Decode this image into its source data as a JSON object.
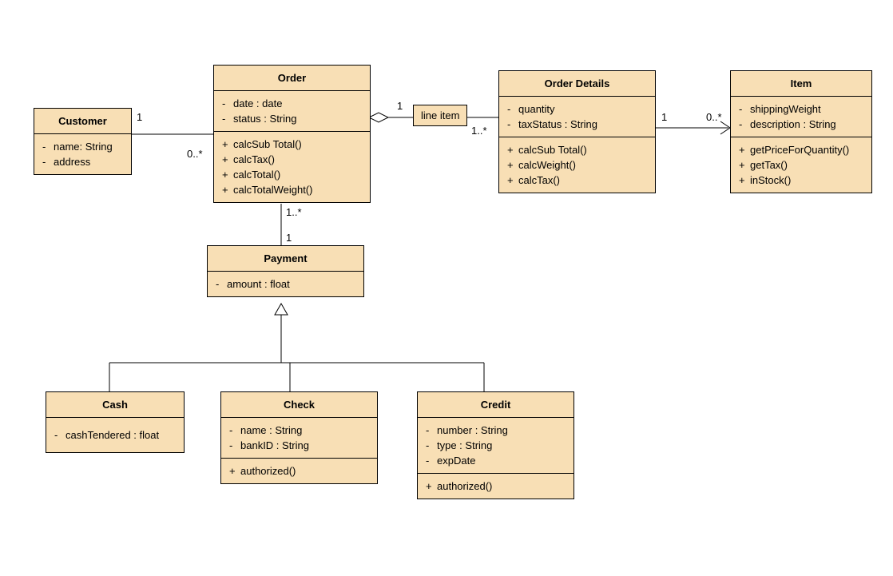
{
  "classes": {
    "customer": {
      "name": "Customer",
      "attrs": [
        {
          "vis": "-",
          "text": "name: String"
        },
        {
          "vis": "-",
          "text": "address"
        }
      ]
    },
    "order": {
      "name": "Order",
      "attrs": [
        {
          "vis": "-",
          "text": "date : date"
        },
        {
          "vis": "-",
          "text": "status : String"
        }
      ],
      "ops": [
        {
          "vis": "+",
          "text": "calcSub Total()"
        },
        {
          "vis": "+",
          "text": "calcTax()"
        },
        {
          "vis": "+",
          "text": "calcTotal()"
        },
        {
          "vis": "+",
          "text": "calcTotalWeight()"
        }
      ]
    },
    "orderDetails": {
      "name": "Order Details",
      "attrs": [
        {
          "vis": "-",
          "text": "quantity"
        },
        {
          "vis": "-",
          "text": "taxStatus : String"
        }
      ],
      "ops": [
        {
          "vis": "+",
          "text": "calcSub Total()"
        },
        {
          "vis": "+",
          "text": "calcWeight()"
        },
        {
          "vis": "+",
          "text": "calcTax()"
        }
      ]
    },
    "item": {
      "name": "Item",
      "attrs": [
        {
          "vis": "-",
          "text": "shippingWeight"
        },
        {
          "vis": "-",
          "text": "description : String"
        }
      ],
      "ops": [
        {
          "vis": "+",
          "text": "getPriceForQuantity()"
        },
        {
          "vis": "+",
          "text": "getTax()"
        },
        {
          "vis": "+",
          "text": "inStock()"
        }
      ]
    },
    "payment": {
      "name": "Payment",
      "attrs": [
        {
          "vis": "-",
          "text": "amount : float"
        }
      ]
    },
    "cash": {
      "name": "Cash",
      "attrs": [
        {
          "vis": "-",
          "text": "cashTendered : float"
        }
      ]
    },
    "check": {
      "name": "Check",
      "attrs": [
        {
          "vis": "-",
          "text": "name : String"
        },
        {
          "vis": "-",
          "text": "bankID : String"
        }
      ],
      "ops": [
        {
          "vis": "+",
          "text": "authorized()"
        }
      ]
    },
    "credit": {
      "name": "Credit",
      "attrs": [
        {
          "vis": "-",
          "text": "number : String"
        },
        {
          "vis": "-",
          "text": "type : String"
        },
        {
          "vis": "-",
          "text": "expDate"
        }
      ],
      "ops": [
        {
          "vis": "+",
          "text": "authorized()"
        }
      ]
    }
  },
  "labels": {
    "lineItem": "line item"
  },
  "mults": {
    "cust_order_cust": "1",
    "cust_order_order": "0..*",
    "order_detail_order": "1",
    "order_detail_detail": "1..*",
    "detail_item_detail": "1",
    "detail_item_item": "0..*",
    "order_payment_order": "1..*",
    "order_payment_payment": "1"
  }
}
